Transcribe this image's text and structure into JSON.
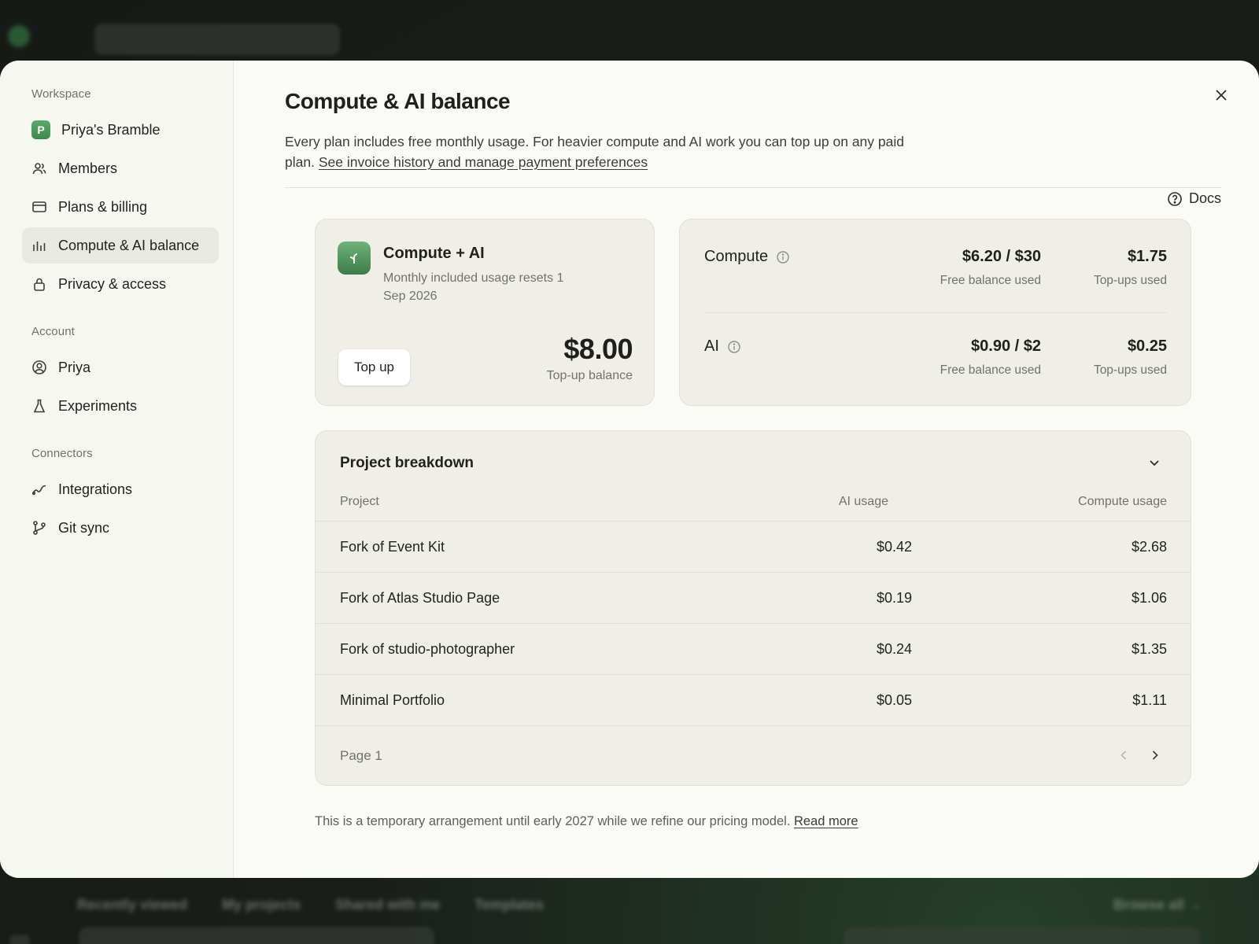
{
  "background": {
    "tabs": [
      "Recently viewed",
      "My projects",
      "Shared with me",
      "Templates"
    ],
    "browse_all": "Browse all →"
  },
  "sidebar": {
    "workspace_label": "Workspace",
    "workspace_avatar": "P",
    "workspace_items": [
      {
        "label": "Priya's Bramble",
        "icon": "workspace-avatar"
      },
      {
        "label": "Members",
        "icon": "users-icon"
      },
      {
        "label": "Plans & billing",
        "icon": "credit-card-icon"
      },
      {
        "label": "Compute & AI balance",
        "icon": "bar-chart-icon",
        "active": true
      },
      {
        "label": "Privacy & access",
        "icon": "lock-icon"
      }
    ],
    "account_label": "Account",
    "account_items": [
      {
        "label": "Priya",
        "icon": "user-circle-icon"
      },
      {
        "label": "Experiments",
        "icon": "flask-icon"
      }
    ],
    "connectors_label": "Connectors",
    "connector_items": [
      {
        "label": "Integrations",
        "icon": "link-icon"
      },
      {
        "label": "Git sync",
        "icon": "git-branch-icon"
      }
    ]
  },
  "main": {
    "title": "Compute & AI balance",
    "description": "Every plan includes free monthly usage. For heavier compute and AI work you can top up on any paid plan.",
    "description_link": "See invoice history and manage payment preferences",
    "docs_label": "Docs",
    "plan_card": {
      "name": "Compute + AI",
      "subtitle": "Monthly included usage resets 1 Sep 2026",
      "topup_button": "Top up",
      "topup_amount": "$8.00",
      "topup_label": "Top-up balance"
    },
    "usage": [
      {
        "name": "Compute",
        "free_value": "$6.20 / $30",
        "free_label": "Free balance used",
        "topup_value": "$1.75",
        "topup_label": "Top-ups used"
      },
      {
        "name": "AI",
        "free_value": "$0.90 / $2",
        "free_label": "Free balance used",
        "topup_value": "$0.25",
        "topup_label": "Top-ups used"
      }
    ],
    "breakdown": {
      "title": "Project breakdown",
      "columns": [
        "Project",
        "AI usage",
        "Compute usage"
      ],
      "rows": [
        {
          "project": "Fork of Event Kit",
          "ai": "$0.42",
          "compute": "$2.68"
        },
        {
          "project": "Fork of Atlas Studio Page",
          "ai": "$0.19",
          "compute": "$1.06"
        },
        {
          "project": "Fork of studio-photographer",
          "ai": "$0.24",
          "compute": "$1.35"
        },
        {
          "project": "Minimal Portfolio",
          "ai": "$0.05",
          "compute": "$1.11"
        }
      ],
      "page_label": "Page 1"
    },
    "footnote": "This is a temporary arrangement until early 2027 while we refine our pricing model.",
    "footnote_link": "Read more"
  },
  "colors": {
    "accent_green": "#3f8a4f",
    "modal_bg": "#fafaf6",
    "card_bg": "#efefe8",
    "active_item_bg": "#e8e9e1"
  }
}
